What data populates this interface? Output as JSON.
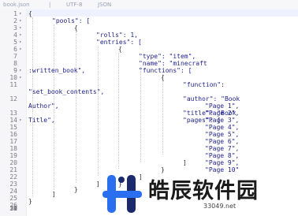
{
  "topbar": {
    "filename": "book.json",
    "separator": "|",
    "encoding": "UTF-8",
    "language": "JSON"
  },
  "lines": [
    {
      "n": "1",
      "fold": "▾"
    },
    {
      "n": "2",
      "fold": "▾"
    },
    {
      "n": "3",
      "fold": "▾"
    },
    {
      "n": "4",
      "fold": "▾"
    },
    {
      "n": "5",
      "fold": "▾"
    },
    {
      "n": "6",
      "fold": "▾"
    },
    {
      "n": "7",
      "fold": ""
    },
    {
      "n": "8",
      "fold": ""
    },
    {
      "n": "9",
      "fold": "▾"
    },
    {
      "n": "10",
      "fold": "▾"
    },
    {
      "n": "11",
      "fold": ""
    },
    {
      "n": "12",
      "fold": ""
    },
    {
      "n": "13",
      "fold": ""
    },
    {
      "n": "14",
      "fold": "▾"
    },
    {
      "n": "15",
      "fold": ""
    },
    {
      "n": "16",
      "fold": ""
    },
    {
      "n": "17",
      "fold": ""
    },
    {
      "n": "18",
      "fold": ""
    },
    {
      "n": "19",
      "fold": ""
    },
    {
      "n": "20",
      "fold": ""
    },
    {
      "n": "21",
      "fold": ""
    },
    {
      "n": "22",
      "fold": ""
    },
    {
      "n": "23",
      "fold": ""
    },
    {
      "n": "24",
      "fold": ""
    },
    {
      "n": "25",
      "fold": ""
    },
    {
      "n": "26",
      "fold": ""
    },
    {
      "n": "27",
      "fold": ""
    },
    {
      "n": "28",
      "fold": ""
    },
    {
      "n": "29",
      "fold": ""
    },
    {
      "n": "30",
      "fold": ""
    },
    {
      "n": "31",
      "fold": ""
    },
    {
      "n": "32",
      "fold": ""
    }
  ],
  "code": {
    "l1": "{",
    "l2": "\"pools\": [",
    "l3": "{",
    "l4": "\"rolls\": 1,",
    "l5": "\"entries\": [",
    "l6": "{",
    "l7": "\"type\": \"item\",",
    "l8": "\"name\": \"minecraft",
    "l8b": ":written_book\",",
    "l9": "\"functions\": [",
    "l10": "{",
    "l11": "\"function\":",
    "l11b": "\"set_book_contents\",",
    "l12": "\"author\": \"Book",
    "l12b": "Author\",",
    "l13": "\"title\": \"Book",
    "l13b": "Title\",",
    "l14": "\"pages\": [",
    "pages": [
      "\"Page 1\",",
      "\"Page 2\",",
      "\"Page 3\",",
      "\"Page 4\",",
      "\"Page 5\",",
      "\"Page 6\",",
      "\"Page 7\",",
      "\"Page 8\",",
      "\"Page 9\",",
      "\"Page 10\""
    ],
    "l25": "]",
    "l26": "}",
    "l27": "]",
    "l28": "}",
    "l29": "]",
    "l30": "}",
    "l31": "]",
    "l32": "}"
  },
  "watermark": {
    "title": "皓辰软件园",
    "url": "33049.net",
    "colors": {
      "logo_blue": "#2a6ff0",
      "logo_dark": "#1b2a6b"
    }
  },
  "colors": {
    "code_text": "#1d1f8a",
    "gutter_bg": "#f6f6f8",
    "line_number": "#7a7a85"
  }
}
